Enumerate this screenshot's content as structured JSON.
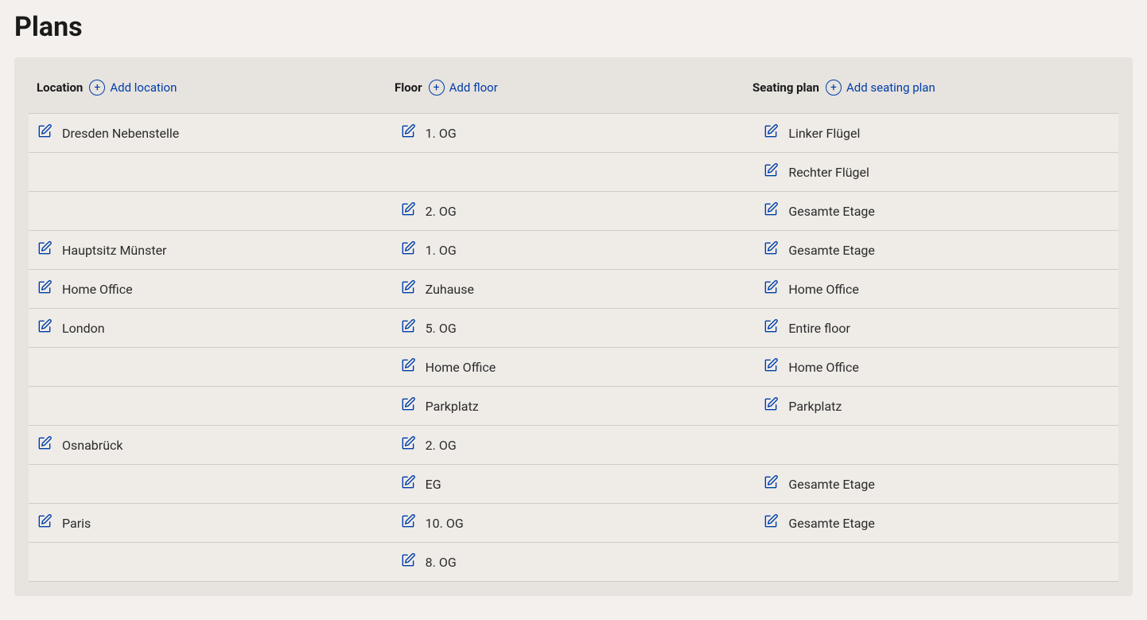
{
  "page": {
    "title": "Plans"
  },
  "columns": {
    "location": {
      "label": "Location",
      "add_label": "Add location"
    },
    "floor": {
      "label": "Floor",
      "add_label": "Add floor"
    },
    "seating": {
      "label": "Seating plan",
      "add_label": "Add seating plan"
    }
  },
  "rows": [
    {
      "location": "Dresden Nebenstelle",
      "floor": "1. OG",
      "seating": "Linker Flügel"
    },
    {
      "location": "",
      "floor": "",
      "seating": "Rechter Flügel"
    },
    {
      "location": "",
      "floor": "2. OG",
      "seating": "Gesamte Etage"
    },
    {
      "location": "Hauptsitz Münster",
      "floor": "1. OG",
      "seating": "Gesamte Etage"
    },
    {
      "location": "Home Office",
      "floor": "Zuhause",
      "seating": "Home Office"
    },
    {
      "location": "London",
      "floor": "5. OG",
      "seating": "Entire floor"
    },
    {
      "location": "",
      "floor": "Home Office",
      "seating": "Home Office"
    },
    {
      "location": "",
      "floor": "Parkplatz",
      "seating": "Parkplatz"
    },
    {
      "location": "Osnabrück",
      "floor": "2. OG",
      "seating": ""
    },
    {
      "location": "",
      "floor": "EG",
      "seating": "Gesamte Etage"
    },
    {
      "location": "Paris",
      "floor": "10. OG",
      "seating": "Gesamte Etage"
    },
    {
      "location": "",
      "floor": "8. OG",
      "seating": ""
    }
  ]
}
